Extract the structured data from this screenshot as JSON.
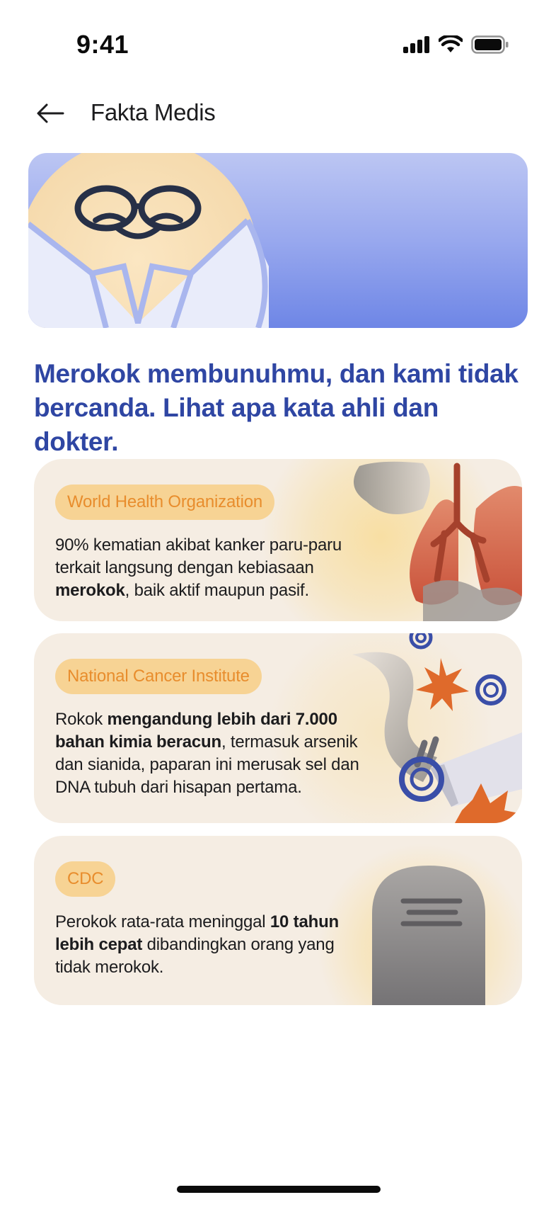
{
  "status_bar": {
    "time": "9:41",
    "icons": [
      "cellular-signal-icon",
      "wifi-icon",
      "battery-icon"
    ]
  },
  "header": {
    "back_icon": "arrow-left-icon",
    "title": "Fakta Medis"
  },
  "hero": {
    "illustration": "doctor-illustration"
  },
  "headline": "Merokok membunuhmu, dan kami tidak bercanda. Lihat apa kata ahli dan dokter.",
  "facts": [
    {
      "source": "World Health Organization",
      "text_a": " 90% kematian akibat kanker paru-paru terkait langsung dengan kebiasaan ",
      "text_bold": "merokok",
      "text_b": ", baik aktif maupun pasif.",
      "illustration": "lungs-smoke-illustration"
    },
    {
      "source": "National Cancer Institute",
      "text_a": "Rokok ",
      "text_bold": "mengandung lebih dari 7.000 bahan kimia beracun",
      "text_b": ", termasuk arsenik dan sianida, paparan ini merusak sel dan DNA tubuh dari hisapan pertama.",
      "illustration": "cigarette-chemicals-illustration"
    },
    {
      "source": "CDC",
      "text_a": "Perokok rata-rata meninggal ",
      "text_bold": "10 tahun lebih cepat",
      "text_b": " dibandingkan orang yang tidak merokok.",
      "illustration": "tombstone-illustration"
    }
  ],
  "colors": {
    "headline": "#2f46a3",
    "card_bg": "#f5ede3",
    "badge_bg": "#f7d394",
    "badge_text": "#e88d2d",
    "hero_gradient_top": "#bcc6f3",
    "hero_gradient_bottom": "#6e86e6"
  }
}
